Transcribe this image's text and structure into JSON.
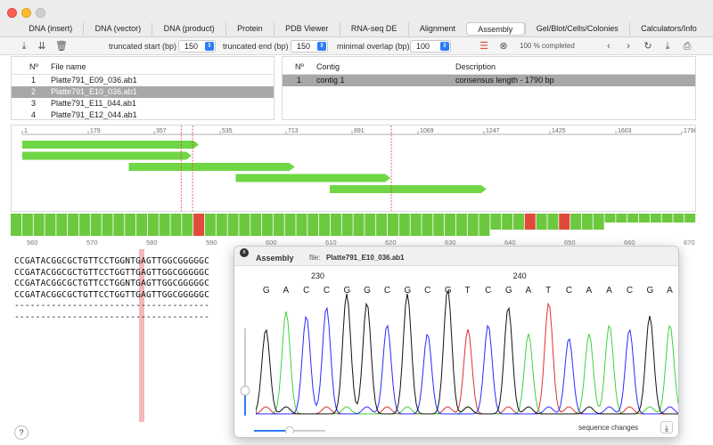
{
  "tabs": [
    "DNA (insert)",
    "DNA (vector)",
    "DNA (product)",
    "Protein",
    "PDB Viewer",
    "RNA-seq DE",
    "Alignment",
    "Assembly",
    "Gel/Blot/Cells/Colonies",
    "Calculators/Info"
  ],
  "active_tab": 7,
  "toolbar": {
    "truncated_start_label": "truncated start (bp)",
    "truncated_start_value": "150",
    "truncated_end_label": "truncated end (bp)",
    "truncated_end_value": "150",
    "minimal_overlap_label": "minimal overlap (bp)",
    "minimal_overlap_value": "100",
    "progress_text": "100 % completed",
    "icons": [
      "import-icon",
      "import-alt-icon",
      "trash-icon",
      "list-view-icon",
      "cancel-icon",
      "back-icon",
      "forward-icon",
      "refresh-icon",
      "download-icon",
      "print-icon"
    ]
  },
  "files_table": {
    "headers": [
      "Nº",
      "File name"
    ],
    "rows": [
      {
        "n": "1",
        "name": "Platte791_E09_036.ab1"
      },
      {
        "n": "2",
        "name": "Platte791_E10_036.ab1"
      },
      {
        "n": "3",
        "name": "Platte791_E11_044.ab1"
      },
      {
        "n": "4",
        "name": "Platte791_E12_044.ab1"
      }
    ],
    "selected_row": 1
  },
  "contigs_table": {
    "headers": [
      "Nº",
      "Contig",
      "Description"
    ],
    "rows": [
      {
        "n": "1",
        "contig": "contig 1",
        "description": "consensus length - 1790 bp"
      }
    ],
    "selected_row": 0
  },
  "overview": {
    "ruler_ticks": [
      "1",
      "179",
      "357",
      "535",
      "713",
      "891",
      "1069",
      "1247",
      "1425",
      "1603",
      "1790"
    ],
    "read_color": "#6fd745",
    "marker_color": "#e04040",
    "reads": [
      {
        "start": 1,
        "end": 480
      },
      {
        "start": 1,
        "end": 460
      },
      {
        "start": 290,
        "end": 740
      },
      {
        "start": 580,
        "end": 1000
      },
      {
        "start": 835,
        "end": 1260
      }
    ],
    "markers": [
      432,
      463,
      1002
    ]
  },
  "quality": {
    "good_color": "#6cc93f",
    "bad_color": "#e04a3a",
    "bad_blocks": [
      16,
      45,
      48
    ]
  },
  "sequence_view": {
    "ruler_ticks": [
      "560",
      "570",
      "580",
      "590",
      "600",
      "610",
      "620",
      "630",
      "640",
      "650",
      "660",
      "670"
    ],
    "lines": [
      "CCGATACGGCGCTGTTCCTGGNTGAGTTGGCGGGGGC",
      "CCGATACGGCGCTGTTCCTGGTTGAGTTGGCGGGGGC",
      "CCGATACGGCGCTGTTCCTGGNTGAGTTGGCGGGGGC",
      "CCGATACGGCGCTGTTCCTGGTTGAGTTGGCGGGGGC",
      "-------------------------------------",
      "-------------------------------------"
    ],
    "highlight_color": "#f4b8b8"
  },
  "help_label": "?",
  "panel": {
    "title": "Assembly",
    "file_label": "file:",
    "file_name": "Platte791_E10_036.ab1",
    "position_labels": [
      "230",
      "240"
    ],
    "bases": [
      "G",
      "A",
      "C",
      "C",
      "G",
      "G",
      "C",
      "G",
      "C",
      "G",
      "T",
      "C",
      "G",
      "A",
      "T",
      "C",
      "A",
      "A",
      "C",
      "G",
      "A"
    ],
    "base_colors": {
      "A": "#3fd23f",
      "C": "#2a2aff",
      "G": "#111111",
      "T": "#e03030"
    },
    "sequence_changes_label": "sequence changes",
    "close_label": "x"
  }
}
